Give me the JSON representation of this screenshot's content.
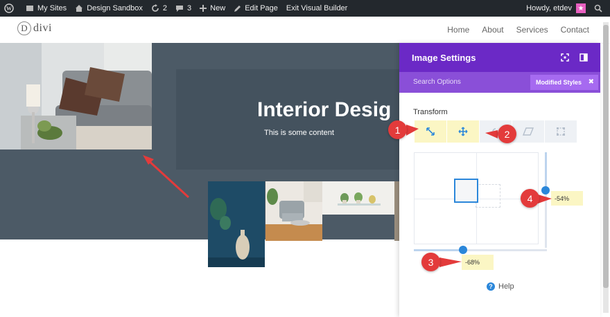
{
  "adminbar": {
    "my_sites": "My Sites",
    "site_name": "Design Sandbox",
    "updates_count": "2",
    "comments_count": "3",
    "new_label": "New",
    "edit_page": "Edit Page",
    "exit_builder": "Exit Visual Builder",
    "howdy": "Howdy, etdev"
  },
  "site": {
    "logo_letter": "D",
    "logo_text": "divi",
    "nav": [
      "Home",
      "About",
      "Services",
      "Contact"
    ]
  },
  "hero": {
    "title": "Interior Desig",
    "subtitle": "This is some content"
  },
  "panel": {
    "title": "Image Settings",
    "search_placeholder": "Search Options",
    "modified_styles": "Modified Styles",
    "section": "Transform",
    "translate_y": "-54%",
    "translate_x": "-68%",
    "help": "Help",
    "accent_color": "#6b29c6",
    "highlight_color": "#fbf6c4"
  },
  "callouts": [
    "1",
    "2",
    "3",
    "4"
  ],
  "colors": {
    "admin_bar": "#23282d",
    "hero_bg": "#4c5a66",
    "callout": "#e33b3b",
    "slider": "#2b87da"
  }
}
